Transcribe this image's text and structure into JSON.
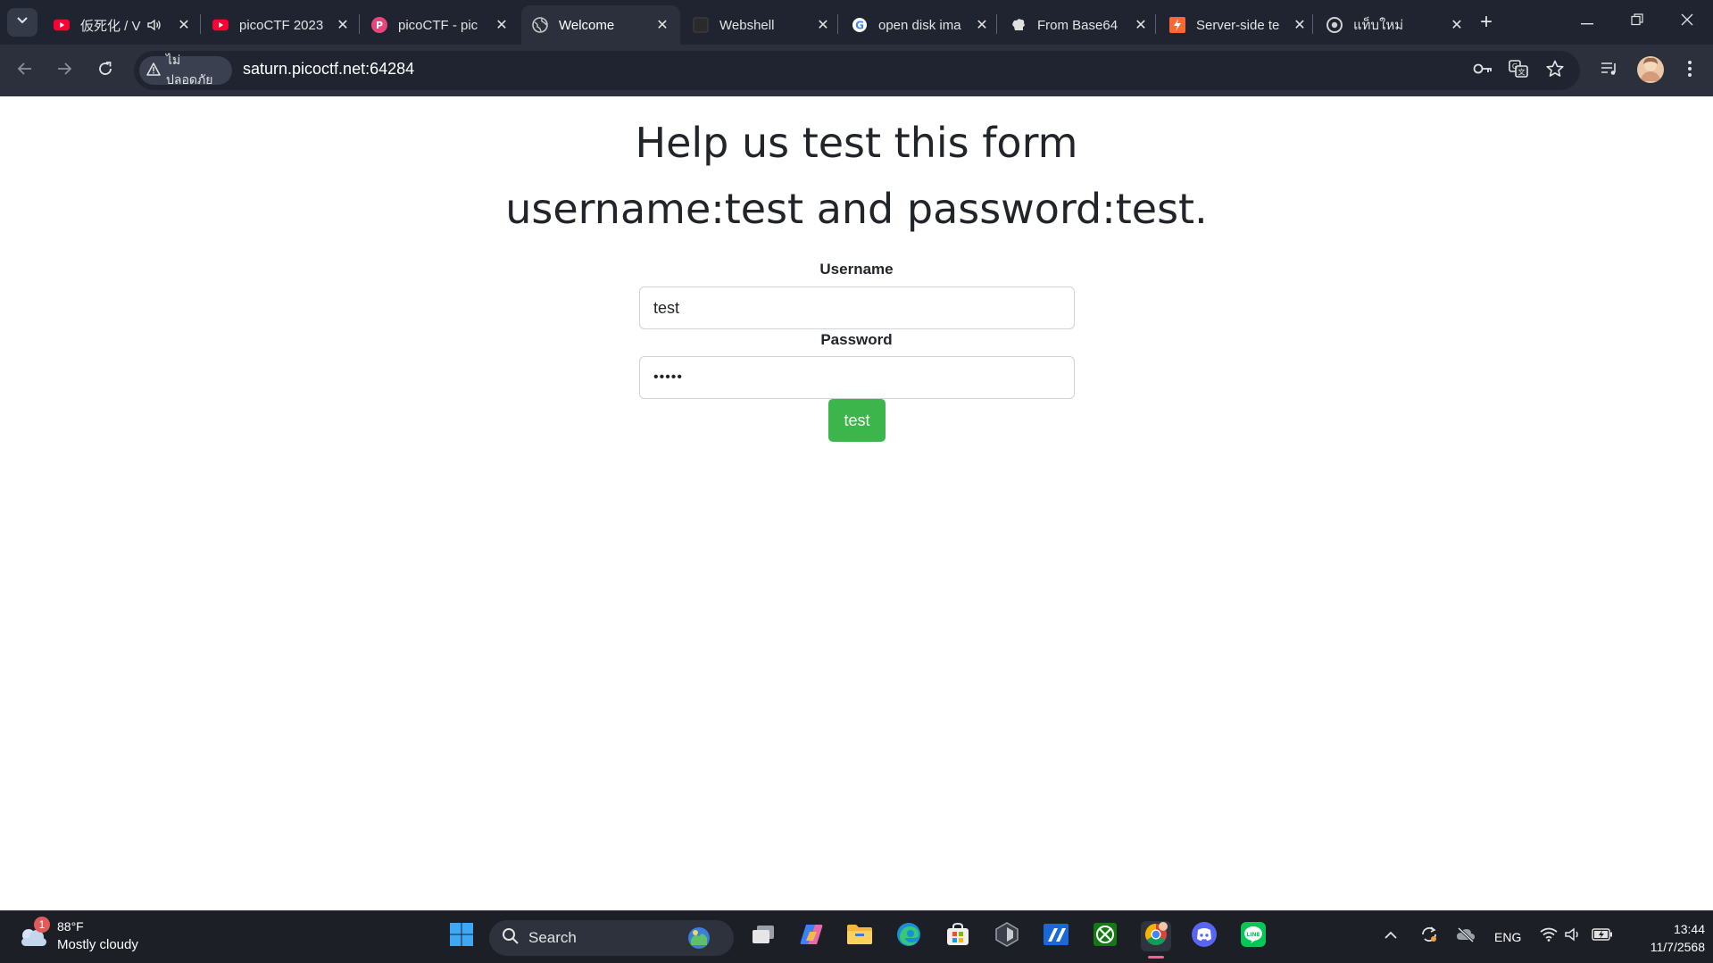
{
  "browser": {
    "tabs": [
      {
        "title": "仮死化 / V",
        "favicon": "youtube-icon",
        "audio": true
      },
      {
        "title": "picoCTF 2023",
        "favicon": "youtube-icon"
      },
      {
        "title": "picoCTF - pic",
        "favicon": "picoctf-icon"
      },
      {
        "title": "Welcome",
        "favicon": "globe-icon",
        "active": true
      },
      {
        "title": "Webshell",
        "favicon": "dark-square-icon"
      },
      {
        "title": "open disk ima",
        "favicon": "google-icon"
      },
      {
        "title": "From Base64",
        "favicon": "cyberchef-icon"
      },
      {
        "title": "Server-side te",
        "favicon": "portswigger-icon"
      },
      {
        "title": "แท็บใหม่",
        "favicon": "chrome-icon"
      }
    ],
    "security_label": "ไม่ปลอดภัย",
    "url": "saturn.picoctf.net:64284"
  },
  "page": {
    "heading_line1": "Help us test this form",
    "heading_line2": "username:test and password:test.",
    "username_label": "Username",
    "username_value": "test",
    "password_label": "Password",
    "password_value": "•••••",
    "submit_label": "test"
  },
  "taskbar": {
    "weather_temp": "88°F",
    "weather_condition": "Mostly cloudy",
    "weather_badge": "1",
    "search_label": "Search",
    "language": "ENG",
    "time": "13:44",
    "date": "11/7/2568"
  },
  "colors": {
    "submit_button": "#3cb54a",
    "tab_strip": "#1f2430",
    "toolbar": "#2b303c"
  }
}
